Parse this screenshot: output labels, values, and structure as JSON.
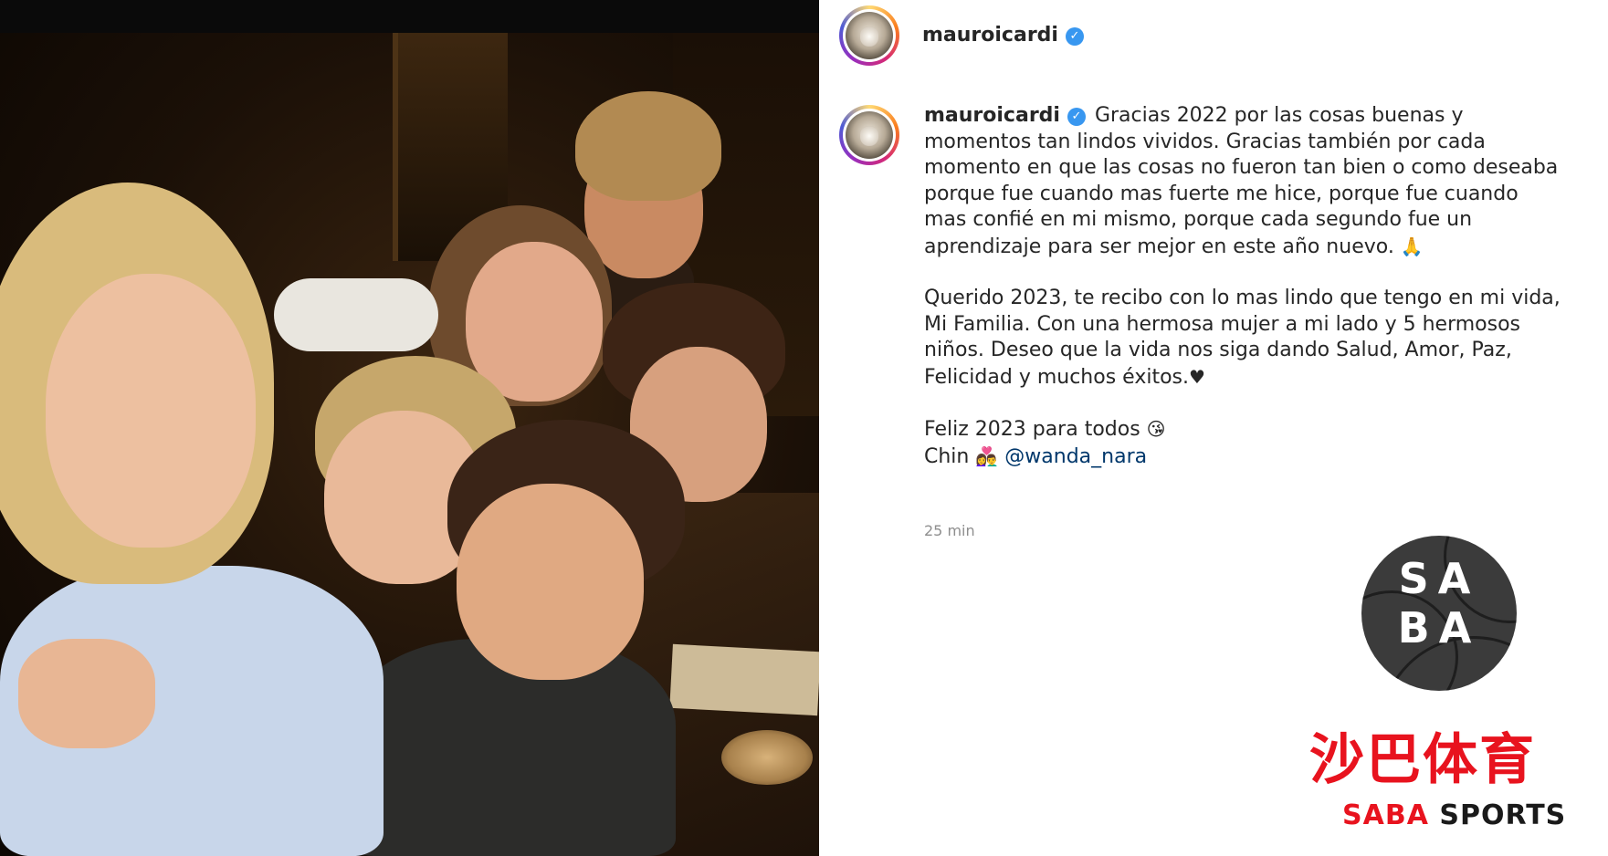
{
  "header": {
    "username": "mauroicardi"
  },
  "post": {
    "username": "mauroicardi",
    "paragraph1": "Gracias 2022 por las cosas buenas y momentos tan lindos vividos. Gracias también por cada momento en que las cosas no fueron tan bien o como deseaba porque fue cuando mas fuerte me hice, porque fue cuando mas confié en mi mismo, porque cada segundo fue un aprendizaje para ser mejor en este año nuevo.",
    "paragraph1_emoji": "🙏",
    "paragraph2": "Querido 2023, te recibo con lo mas lindo que tengo en mi vida, Mi Familia. Con una hermosa mujer a mi lado y 5 hermosos niños. Deseo que la vida nos siga dando Salud, Amor, Paz, Felicidad y muchos éxitos.",
    "paragraph2_emoji": "♥",
    "line3": "Feliz 2023 para todos",
    "line3_emoji": "😘",
    "line4_prefix": "Chin",
    "line4_emoji": "👩‍❤️‍👨",
    "mention": "@wanda_nara",
    "timestamp": "25 min"
  },
  "watermark": {
    "logo_top": "SA",
    "logo_bottom": "BA",
    "chinese": "沙巴体育",
    "english_red": "SABA",
    "english_dark": " SPORTS"
  },
  "colors": {
    "verified": "#3897f0",
    "mention": "#00376b",
    "timestamp": "#8e8e8e",
    "brand_red": "#e8131e"
  }
}
